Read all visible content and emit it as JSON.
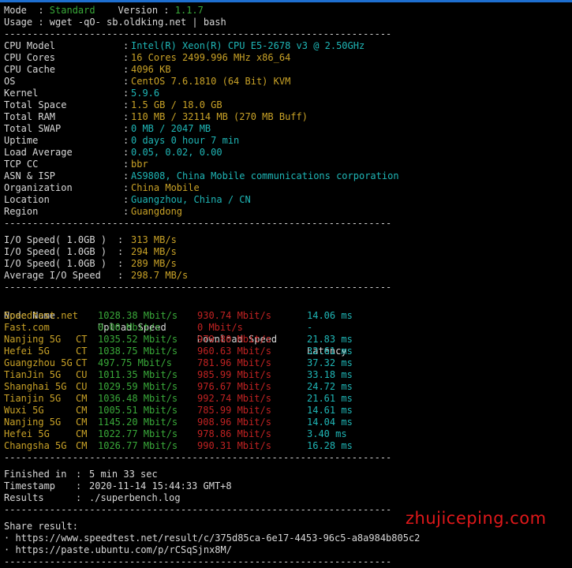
{
  "header": {
    "mode_label": "Mode  : ",
    "mode_value": "Standard",
    "version_label": "    Version : ",
    "version_value": "1.1.7",
    "usage": "Usage : wget -qO- sb.oldking.net | bash"
  },
  "separator": "--------------------------------------------------------------------",
  "system_info": [
    {
      "key": "CPU Model",
      "value": "Intel(R) Xeon(R) CPU E5-2678 v3 @ 2.50GHz",
      "color": "cyan"
    },
    {
      "key": "CPU Cores",
      "value": "16 Cores 2499.996 MHz x86_64",
      "color": "yellow"
    },
    {
      "key": "CPU Cache",
      "value": "4096 KB",
      "color": "yellow"
    },
    {
      "key": "OS",
      "value": "CentOS 7.6.1810 (64 Bit) KVM",
      "color": "yellow"
    },
    {
      "key": "Kernel",
      "value": "5.9.6",
      "color": "cyan"
    },
    {
      "key": "Total Space",
      "value": "1.5 GB / 18.0 GB",
      "color": "yellow"
    },
    {
      "key": "Total RAM",
      "value": "110 MB / 32114 MB (270 MB Buff)",
      "color": "yellow"
    },
    {
      "key": "Total SWAP",
      "value": "0 MB / 2047 MB",
      "color": "cyan"
    },
    {
      "key": "Uptime",
      "value": "0 days 0 hour 7 min",
      "color": "cyan"
    },
    {
      "key": "Load Average",
      "value": "0.05, 0.02, 0.00",
      "color": "cyan"
    },
    {
      "key": "TCP CC",
      "value": "bbr",
      "color": "yellow"
    },
    {
      "key": "ASN & ISP",
      "value": "AS9808, China Mobile communications corporation",
      "color": "cyan"
    },
    {
      "key": "Organization",
      "value": "China Mobile",
      "color": "yellow"
    },
    {
      "key": "Location",
      "value": "Guangzhou, China / CN",
      "color": "cyan"
    },
    {
      "key": "Region",
      "value": "Guangdong",
      "color": "yellow"
    }
  ],
  "io_speed": [
    {
      "key": "I/O Speed( 1.0GB )",
      "value": "313 MB/s"
    },
    {
      "key": "I/O Speed( 1.0GB )",
      "value": "294 MB/s"
    },
    {
      "key": "I/O Speed( 1.0GB )",
      "value": "289 MB/s"
    },
    {
      "key": "Average I/O Speed",
      "value": "298.7 MB/s"
    }
  ],
  "speedtest_headers": {
    "node": "Node Name",
    "upload": "Upload Speed",
    "download": "Download Speed",
    "latency": "Latency"
  },
  "speedtest": [
    {
      "node": "Speedtest.net",
      "isp": "",
      "upload": "1028.38 Mbit/s",
      "download": "930.74 Mbit/s",
      "latency": "14.06 ms"
    },
    {
      "node": "Fast.com",
      "isp": "",
      "upload": "0.00 Mbit/s",
      "download": "0 Mbit/s",
      "latency": "-"
    },
    {
      "node": "Nanjing 5G",
      "isp": "CT",
      "upload": "1035.52 Mbit/s",
      "download": "979.80 Mbit/s",
      "latency": "21.83 ms"
    },
    {
      "node": "Hefei 5G",
      "isp": "CT",
      "upload": "1038.75 Mbit/s",
      "download": "960.63 Mbit/s",
      "latency": "32.61 ms"
    },
    {
      "node": "Guangzhou 5G",
      "isp": "CT",
      "upload": "497.75 Mbit/s",
      "download": "781.96 Mbit/s",
      "latency": "37.32 ms"
    },
    {
      "node": "TianJin 5G",
      "isp": "CU",
      "upload": "1011.35 Mbit/s",
      "download": "985.99 Mbit/s",
      "latency": "33.18 ms"
    },
    {
      "node": "Shanghai 5G",
      "isp": "CU",
      "upload": "1029.59 Mbit/s",
      "download": "976.67 Mbit/s",
      "latency": "24.72 ms"
    },
    {
      "node": "Tianjin 5G",
      "isp": "CM",
      "upload": "1036.48 Mbit/s",
      "download": "992.74 Mbit/s",
      "latency": "21.61 ms"
    },
    {
      "node": "Wuxi 5G",
      "isp": "CM",
      "upload": "1005.51 Mbit/s",
      "download": "785.99 Mbit/s",
      "latency": "14.61 ms"
    },
    {
      "node": "Nanjing 5G",
      "isp": "CM",
      "upload": "1145.20 Mbit/s",
      "download": "908.96 Mbit/s",
      "latency": "14.04 ms"
    },
    {
      "node": "Hefei 5G",
      "isp": "CM",
      "upload": "1022.77 Mbit/s",
      "download": "978.86 Mbit/s",
      "latency": "3.40 ms"
    },
    {
      "node": "Changsha 5G",
      "isp": "CM",
      "upload": "1026.77 Mbit/s",
      "download": "990.31 Mbit/s",
      "latency": "16.28 ms"
    }
  ],
  "status": [
    {
      "key": "Finished in",
      "value": "5 min 33 sec"
    },
    {
      "key": "Timestamp",
      "value": "2020-11-14 15:44:33 GMT+8"
    },
    {
      "key": "Results",
      "value": "./superbench.log"
    }
  ],
  "share": {
    "label": "Share result:",
    "links": [
      "· https://www.speedtest.net/result/c/375d85ca-6e17-4453-96c5-a8a984b805c2",
      "· https://paste.ubuntu.com/p/rCSqSjnx8M/"
    ]
  },
  "watermark": "zhujiceping.com",
  "colors": {
    "accent_bar": "#1e6fd0",
    "cyan": "#1fb6b6",
    "yellow": "#c9a227",
    "green": "#39a939",
    "red": "#c02222",
    "watermark": "#e0181a"
  }
}
